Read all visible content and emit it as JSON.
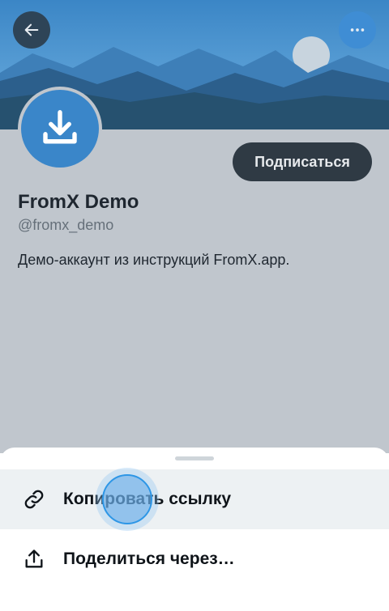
{
  "profile": {
    "display_name": "FromX Demo",
    "handle": "@fromx_demo",
    "bio": "Демо-аккаунт из инструкций FromX.app.",
    "follow_label": "Подписаться"
  },
  "icons": {
    "back": "arrow-left-icon",
    "more": "more-horizontal-icon",
    "avatar": "download-icon",
    "copy": "link-icon",
    "share": "share-icon"
  },
  "sheet": {
    "items": [
      {
        "label": "Копировать ссылку",
        "icon": "link-icon"
      },
      {
        "label": "Поделиться через…",
        "icon": "share-icon"
      }
    ]
  },
  "colors": {
    "banner_sky": "#4a8dc4",
    "avatar_bg": "#3a86c9",
    "follow_button_bg": "#2f3a44",
    "overlay_dim": "#c0c6cd",
    "touch_indicator": "#2d96e6"
  }
}
